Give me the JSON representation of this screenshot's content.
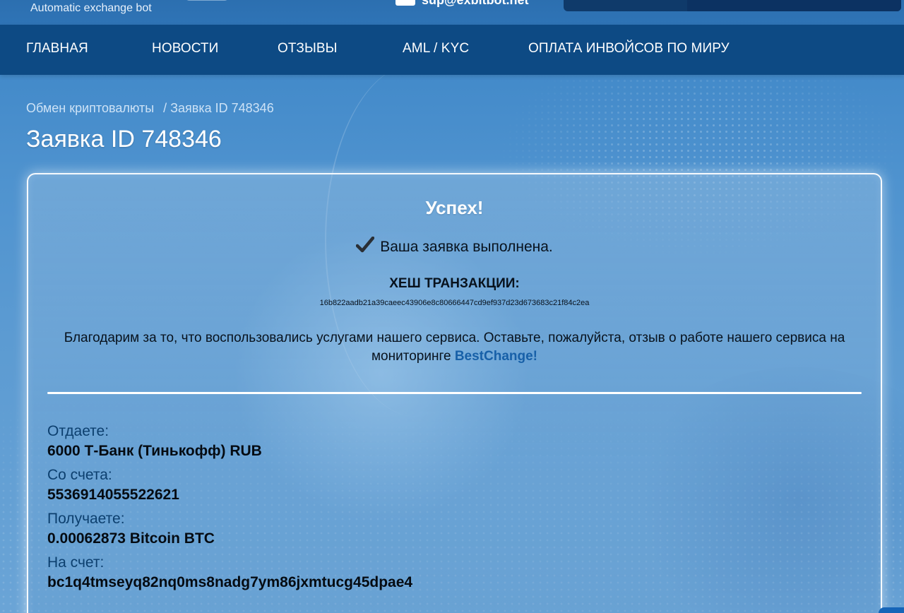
{
  "header": {
    "tagline": "Automatic exchange bot",
    "email": "sup@exbitbot.net",
    "lang_left": "",
    "lang_right": ""
  },
  "nav": {
    "items": [
      {
        "label": "ГЛАВНАЯ"
      },
      {
        "label": "НОВОСТИ"
      },
      {
        "label": "ОТЗЫВЫ"
      },
      {
        "label": "AML / KYC"
      },
      {
        "label": "ОПЛАТА ИНВОЙСОВ ПО МИРУ"
      }
    ]
  },
  "breadcrumb": {
    "home": "Обмен криптовалюты",
    "current": "/ Заявка ID 748346"
  },
  "page_title": "Заявка ID 748346",
  "card": {
    "success_title": "Успех!",
    "status_icon": "check-mark-icon",
    "status_text": "Ваша заявка выполнена.",
    "hash_label": "ХЕШ ТРАНЗАКЦИИ:",
    "hash_value": "16b822aadb21a39caeec43906e8c80666447cd9ef937d23d673683c21f84c2ea",
    "thanks_text": "Благодарим за то, что воспользовались услугами нашего сервиса. Оставьте, пожалуйста, отзыв о работе нашего сервиса на мониторинге",
    "thanks_link": "BestChange!",
    "details": [
      {
        "label": "Отдаете:",
        "value": "6000 Т-Банк (Тинькофф) RUB"
      },
      {
        "label": "Со счета:",
        "value": "5536914055522621"
      },
      {
        "label": "Получаете:",
        "value": "0.00062873 Bitcoin BTC"
      },
      {
        "label": "На счет:",
        "value": "bc1q4tmseyq82nq0ms8nadg7ym86jxmtucg45dpae4"
      }
    ]
  },
  "colors": {
    "nav_bg": "#0d4a84",
    "link": "#1760a8",
    "label": "#0c3f6e"
  }
}
